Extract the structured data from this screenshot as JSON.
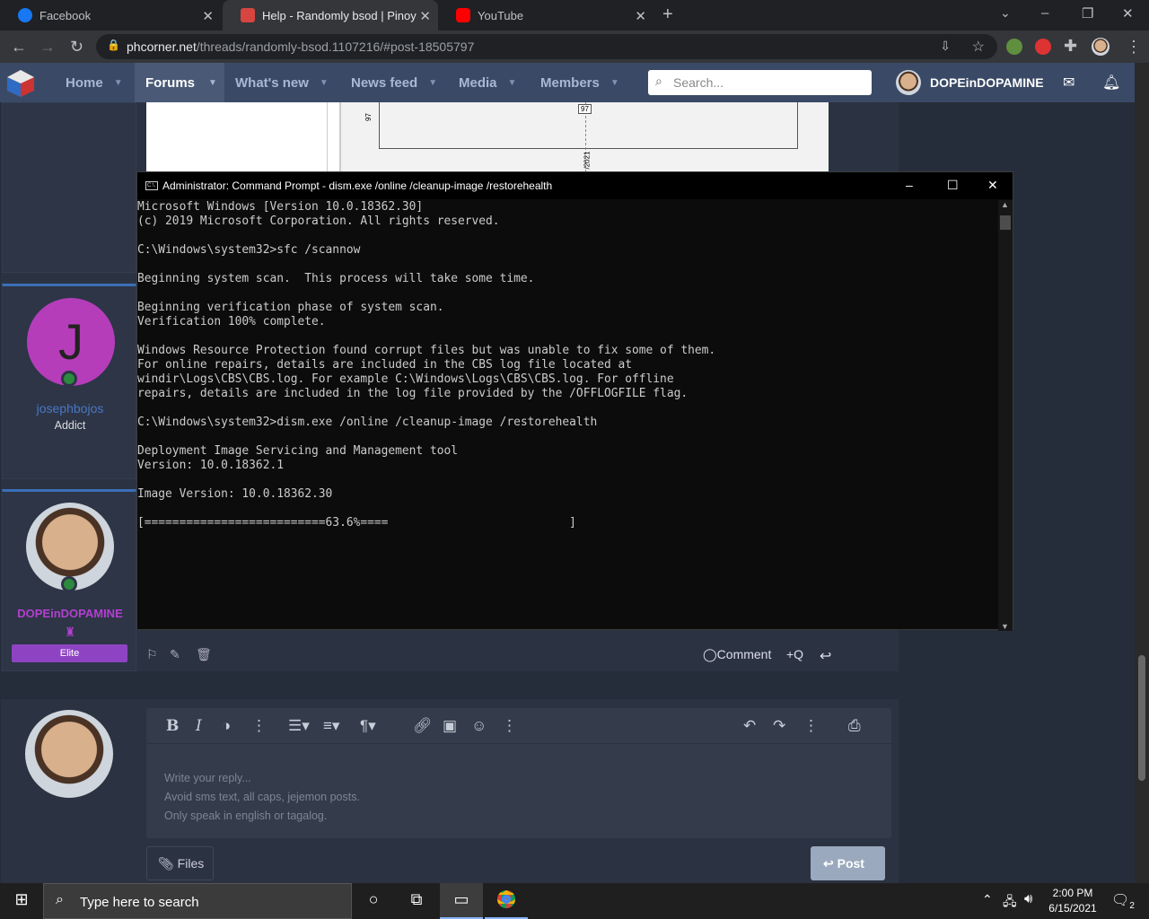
{
  "browser": {
    "tabs": [
      {
        "title": "Facebook",
        "color": "#1877f2"
      },
      {
        "title": "Help - Randomly bsod | Pinoy Int",
        "color": "#d64540"
      },
      {
        "title": "YouTube",
        "color": "#ff0000"
      }
    ],
    "url_host": "phcorner.net",
    "url_path": "/threads/randomly-bsod.1107216/#post-18505797"
  },
  "site": {
    "nav": [
      {
        "label": "Home"
      },
      {
        "label": "Forums"
      },
      {
        "label": "What's new"
      },
      {
        "label": "News feed"
      },
      {
        "label": "Media"
      },
      {
        "label": "Members"
      }
    ],
    "search_placeholder": "Search...",
    "username": "DOPEinDOPAMINE"
  },
  "image_fragment": {
    "value_label": "97",
    "tick_label": "97",
    "date_fragment": "/2021"
  },
  "cmd": {
    "title": "Administrator: Command Prompt - dism.exe  /online /cleanup-image /restorehealth",
    "icon_text": "C:\\.",
    "lines": [
      "Microsoft Windows [Version 10.0.18362.30]",
      "(c) 2019 Microsoft Corporation. All rights reserved.",
      "",
      "C:\\Windows\\system32>sfc /scannow",
      "",
      "Beginning system scan.  This process will take some time.",
      "",
      "Beginning verification phase of system scan.",
      "Verification 100% complete.",
      "",
      "Windows Resource Protection found corrupt files but was unable to fix some of them.",
      "For online repairs, details are included in the CBS log file located at",
      "windir\\Logs\\CBS\\CBS.log. For example C:\\Windows\\Logs\\CBS\\CBS.log. For offline",
      "repairs, details are included in the log file provided by the /OFFLOGFILE flag.",
      "",
      "C:\\Windows\\system32>dism.exe /online /cleanup-image /restorehealth",
      "",
      "Deployment Image Servicing and Management tool",
      "Version: 10.0.18362.1",
      "",
      "Image Version: 10.0.18362.30",
      "",
      "[==========================63.6%====                          ]"
    ]
  },
  "posters": [
    {
      "initial": "J",
      "name": "josephbojos",
      "title": "Addict",
      "name_color": "#4a78c2"
    },
    {
      "name": "DOPEinDOPAMINE",
      "badge": "Elite",
      "name_color": "#b43fd0"
    }
  ],
  "post_actions": {
    "comment": "Comment",
    "quote": "+Q"
  },
  "editor": {
    "placeholder_lines": [
      "Write your reply...",
      "Avoid sms text, all caps, jejemon posts.",
      "Only speak in english or tagalog."
    ],
    "files_label": "Files",
    "post_label": "Post"
  },
  "taskbar": {
    "search_placeholder": "Type here to search",
    "time": "2:00 PM",
    "date": "6/15/2021",
    "notifications": "2"
  }
}
